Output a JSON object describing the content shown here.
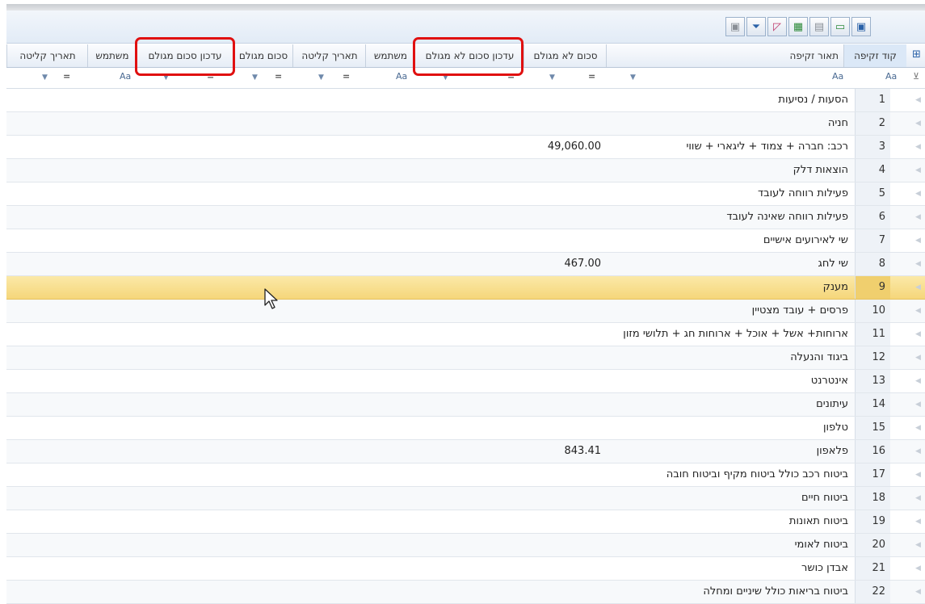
{
  "toolbar": {
    "buttons": [
      {
        "name": "export-excel-icon",
        "glyph": "▣"
      },
      {
        "name": "print-icon",
        "glyph": "▤"
      },
      {
        "name": "table-view-icon",
        "glyph": "▦"
      },
      {
        "name": "edit-icon",
        "glyph": "◸"
      },
      {
        "name": "filter-funnel-icon",
        "glyph": "⏷"
      },
      {
        "name": "save-icon",
        "glyph": "▭"
      }
    ]
  },
  "columns": [
    {
      "key": "code",
      "label": "קוד זקיפה"
    },
    {
      "key": "desc",
      "label": "תאור זקיפה"
    },
    {
      "key": "amount_plain",
      "label": "סכום לא מגולם"
    },
    {
      "key": "update_plain",
      "label": "עדכון סכום לא מגולם"
    },
    {
      "key": "user1",
      "label": "משתמש"
    },
    {
      "key": "date1",
      "label": "תאריך קליטה"
    },
    {
      "key": "amount_gross",
      "label": "סכום מגולם"
    },
    {
      "key": "update_gross",
      "label": "עדכון סכום מגולם"
    },
    {
      "key": "user2",
      "label": "משתמש"
    },
    {
      "key": "date2",
      "label": "תאריך קליטה"
    }
  ],
  "filter_text_label": "Aa",
  "filter_eq": "=",
  "rows": [
    {
      "n": "1",
      "desc": "הסעות / נסיעות",
      "amount": ""
    },
    {
      "n": "2",
      "desc": "חניה",
      "amount": ""
    },
    {
      "n": "3",
      "desc": "רכב: חברה + צמוד + ליגארי + שווי",
      "amount": "49,060.00"
    },
    {
      "n": "4",
      "desc": "הוצאות דלק",
      "amount": ""
    },
    {
      "n": "5",
      "desc": "פעילות רווחה לעובד",
      "amount": ""
    },
    {
      "n": "6",
      "desc": "פעילות רווחה שאינה לעובד",
      "amount": ""
    },
    {
      "n": "7",
      "desc": "שי לאירועים אישיים",
      "amount": ""
    },
    {
      "n": "8",
      "desc": "שי לחג",
      "amount": "467.00"
    },
    {
      "n": "9",
      "desc": "מענק",
      "amount": ""
    },
    {
      "n": "10",
      "desc": "פרסים + עובד מצטיין",
      "amount": ""
    },
    {
      "n": "11",
      "desc": "ארוחות+ אשל + אוכל + ארוחות חג + תלושי מזון",
      "amount": ""
    },
    {
      "n": "12",
      "desc": "ביגוד והנעלה",
      "amount": ""
    },
    {
      "n": "13",
      "desc": "אינטרנט",
      "amount": ""
    },
    {
      "n": "14",
      "desc": "עיתונים",
      "amount": ""
    },
    {
      "n": "15",
      "desc": "טלפון",
      "amount": ""
    },
    {
      "n": "16",
      "desc": "פלאפון",
      "amount": "843.41"
    },
    {
      "n": "17",
      "desc": "ביטוח רכב כולל ביטוח מקיף וביטוח חובה",
      "amount": ""
    },
    {
      "n": "18",
      "desc": "ביטוח חיים",
      "amount": ""
    },
    {
      "n": "19",
      "desc": "ביטוח תאונות",
      "amount": ""
    },
    {
      "n": "20",
      "desc": "ביטוח לאומי",
      "amount": ""
    },
    {
      "n": "21",
      "desc": "אבדן כושר",
      "amount": ""
    },
    {
      "n": "22",
      "desc": "ביטוח בריאות כולל שיניים ומחלה",
      "amount": ""
    }
  ],
  "selected_row": "9"
}
